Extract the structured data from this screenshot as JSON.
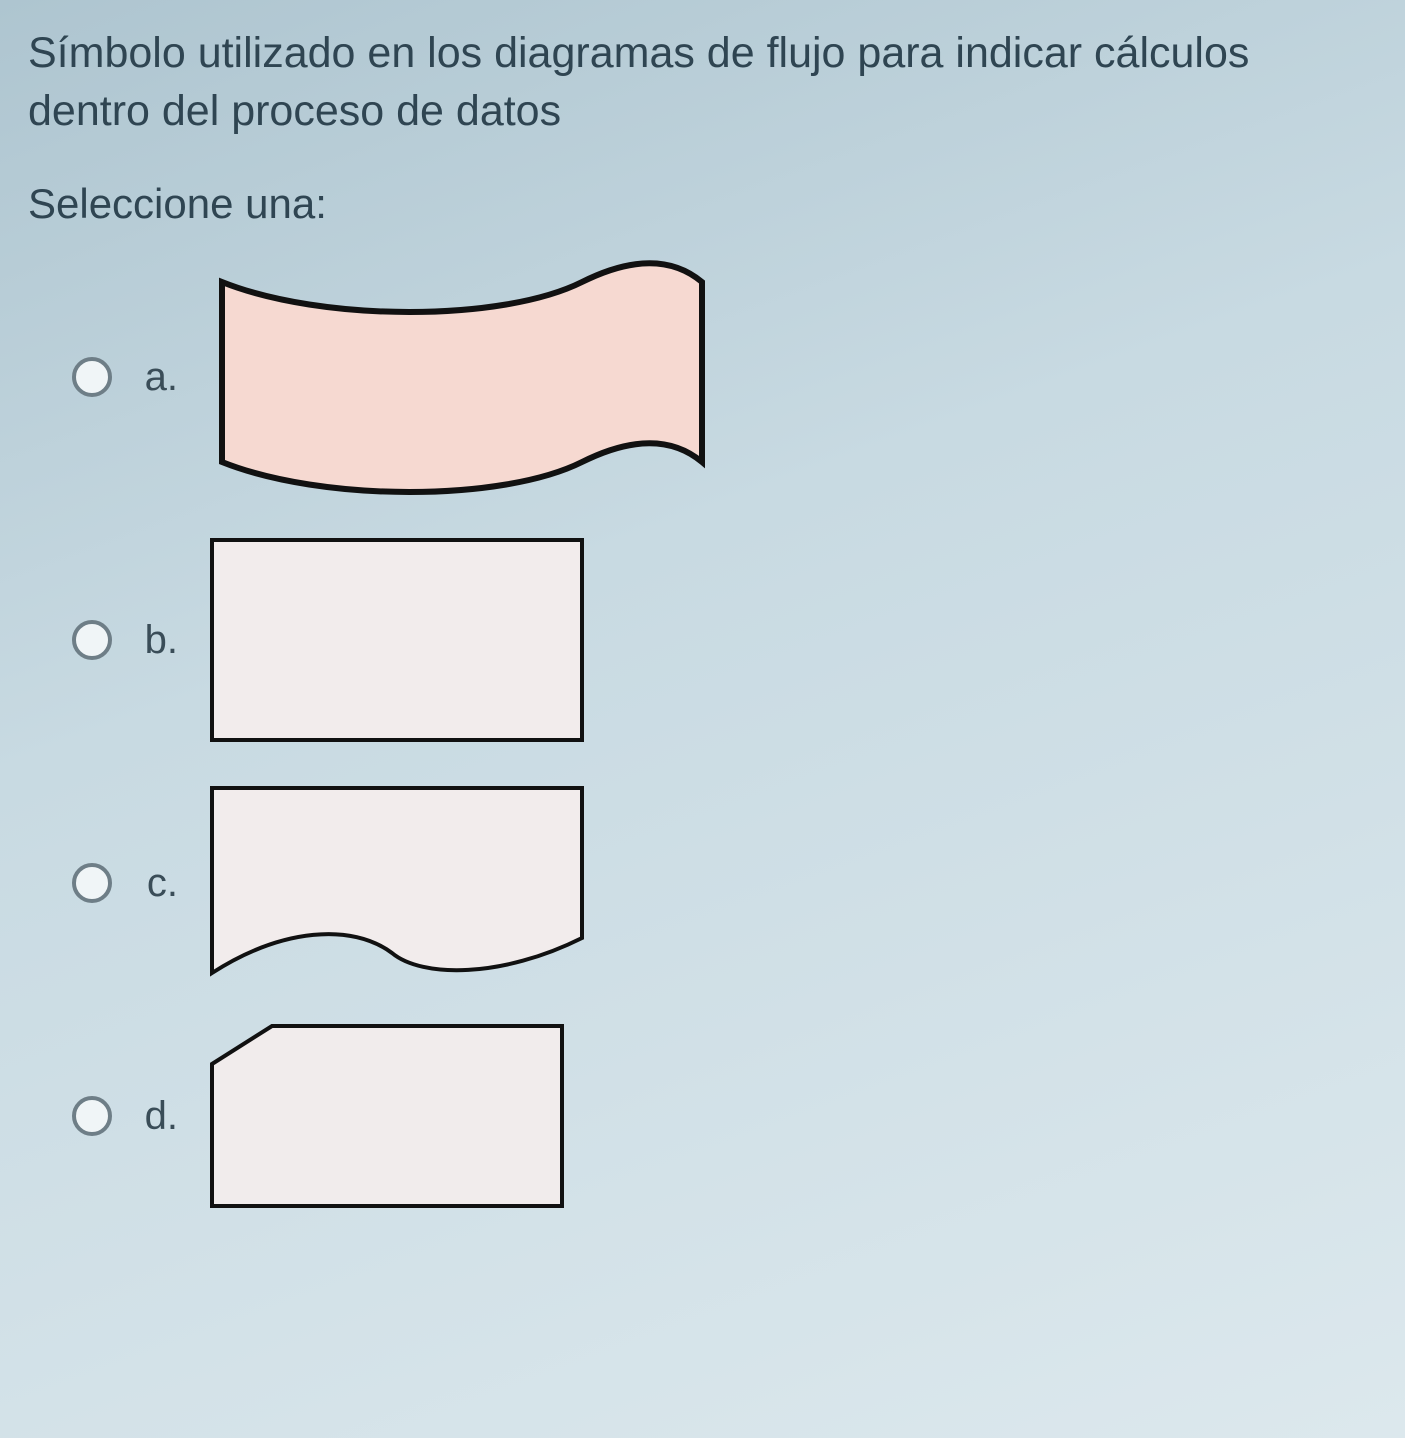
{
  "question": {
    "text": "Símbolo utilizado en los diagramas de flujo para indicar cálculos dentro del proceso de datos",
    "select_label": "Seleccione una:"
  },
  "options": {
    "a": {
      "label": "a.",
      "shape": "flag-wave"
    },
    "b": {
      "label": "b.",
      "shape": "rectangle"
    },
    "c": {
      "label": "c.",
      "shape": "document"
    },
    "d": {
      "label": "d.",
      "shape": "card"
    }
  }
}
